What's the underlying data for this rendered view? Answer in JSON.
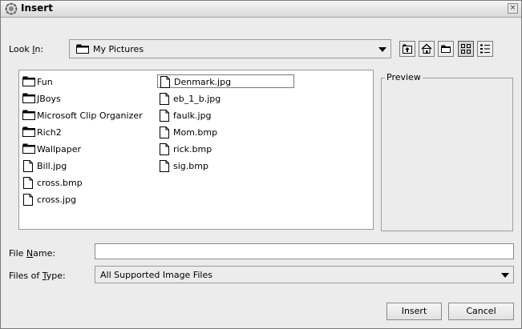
{
  "window": {
    "title": "Insert",
    "close_glyph": "×"
  },
  "look_in": {
    "label_pre": "Look ",
    "label_mnemonic": "I",
    "label_post": "n:",
    "selected": "My Pictures"
  },
  "toolbar": [
    {
      "name": "up-one-level-icon"
    },
    {
      "name": "home-icon"
    },
    {
      "name": "new-folder-icon"
    },
    {
      "name": "list-view-icon",
      "pressed": true
    },
    {
      "name": "details-view-icon"
    }
  ],
  "files": {
    "column1": [
      {
        "name": "Fun",
        "type": "folder"
      },
      {
        "name": "JBoys",
        "type": "folder"
      },
      {
        "name": "Microsoft Clip Organizer",
        "type": "folder"
      },
      {
        "name": "Rich2",
        "type": "folder"
      },
      {
        "name": "Wallpaper",
        "type": "folder"
      },
      {
        "name": "Bill.jpg",
        "type": "file"
      },
      {
        "name": "cross.bmp",
        "type": "file"
      },
      {
        "name": "cross.jpg",
        "type": "file"
      }
    ],
    "column2": [
      {
        "name": "Denmark.jpg",
        "type": "file",
        "selected": true
      },
      {
        "name": "eb_1_b.jpg",
        "type": "file"
      },
      {
        "name": "faulk.jpg",
        "type": "file"
      },
      {
        "name": "Mom.bmp",
        "type": "file"
      },
      {
        "name": "rick.bmp",
        "type": "file"
      },
      {
        "name": "sig.bmp",
        "type": "file"
      }
    ]
  },
  "preview": {
    "label": "Preview"
  },
  "file_name": {
    "label_pre": "File ",
    "label_mnemonic": "N",
    "label_post": "ame:",
    "value": ""
  },
  "file_type": {
    "label_pre": "Files of ",
    "label_mnemonic": "T",
    "label_post": "ype:",
    "selected": "All Supported Image Files"
  },
  "buttons": {
    "insert": "Insert",
    "cancel": "Cancel"
  },
  "colors": {
    "dialog_bg": "#ececec",
    "list_bg": "#ffffff"
  }
}
